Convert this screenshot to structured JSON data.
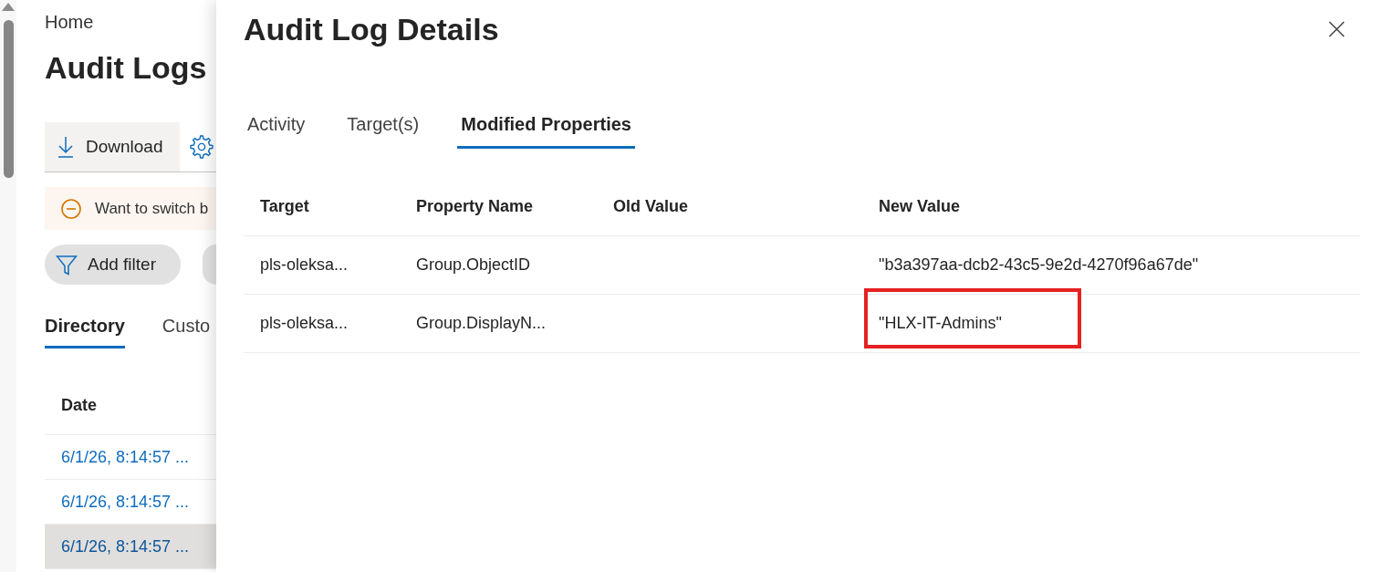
{
  "page": {
    "breadcrumb": "Home",
    "title": "Audit Logs",
    "toolbar": {
      "download": "Download"
    },
    "banner": {
      "text": "Want to switch b"
    },
    "filter_button": "Add filter",
    "tabs": [
      {
        "label": "Directory",
        "selected": true
      },
      {
        "label": "Custo",
        "selected": false
      }
    ],
    "table": {
      "columns": [
        "Date"
      ],
      "rows": [
        {
          "date": "6/1/26, 8:14:57 ...",
          "selected": false
        },
        {
          "date": "6/1/26, 8:14:57 ...",
          "selected": false
        },
        {
          "date": "6/1/26, 8:14:57 ...",
          "selected": true
        }
      ]
    }
  },
  "panel": {
    "title": "Audit Log Details",
    "tabs": [
      {
        "label": "Activity",
        "selected": false
      },
      {
        "label": "Target(s)",
        "selected": false
      },
      {
        "label": "Modified Properties",
        "selected": true
      }
    ],
    "table": {
      "columns": [
        "Target",
        "Property Name",
        "Old Value",
        "New Value"
      ],
      "rows": [
        {
          "target": "pls-oleksa...",
          "property_name": "Group.ObjectID",
          "new_value": "\"b3a397aa-dcb2-43c5-9e2d-4270f96a67de\"",
          "highlighted": false
        },
        {
          "target": "pls-oleksa...",
          "property_name": "Group.DisplayN...",
          "new_value": "\"HLX-IT-Admins\"",
          "highlighted": true
        }
      ]
    }
  }
}
